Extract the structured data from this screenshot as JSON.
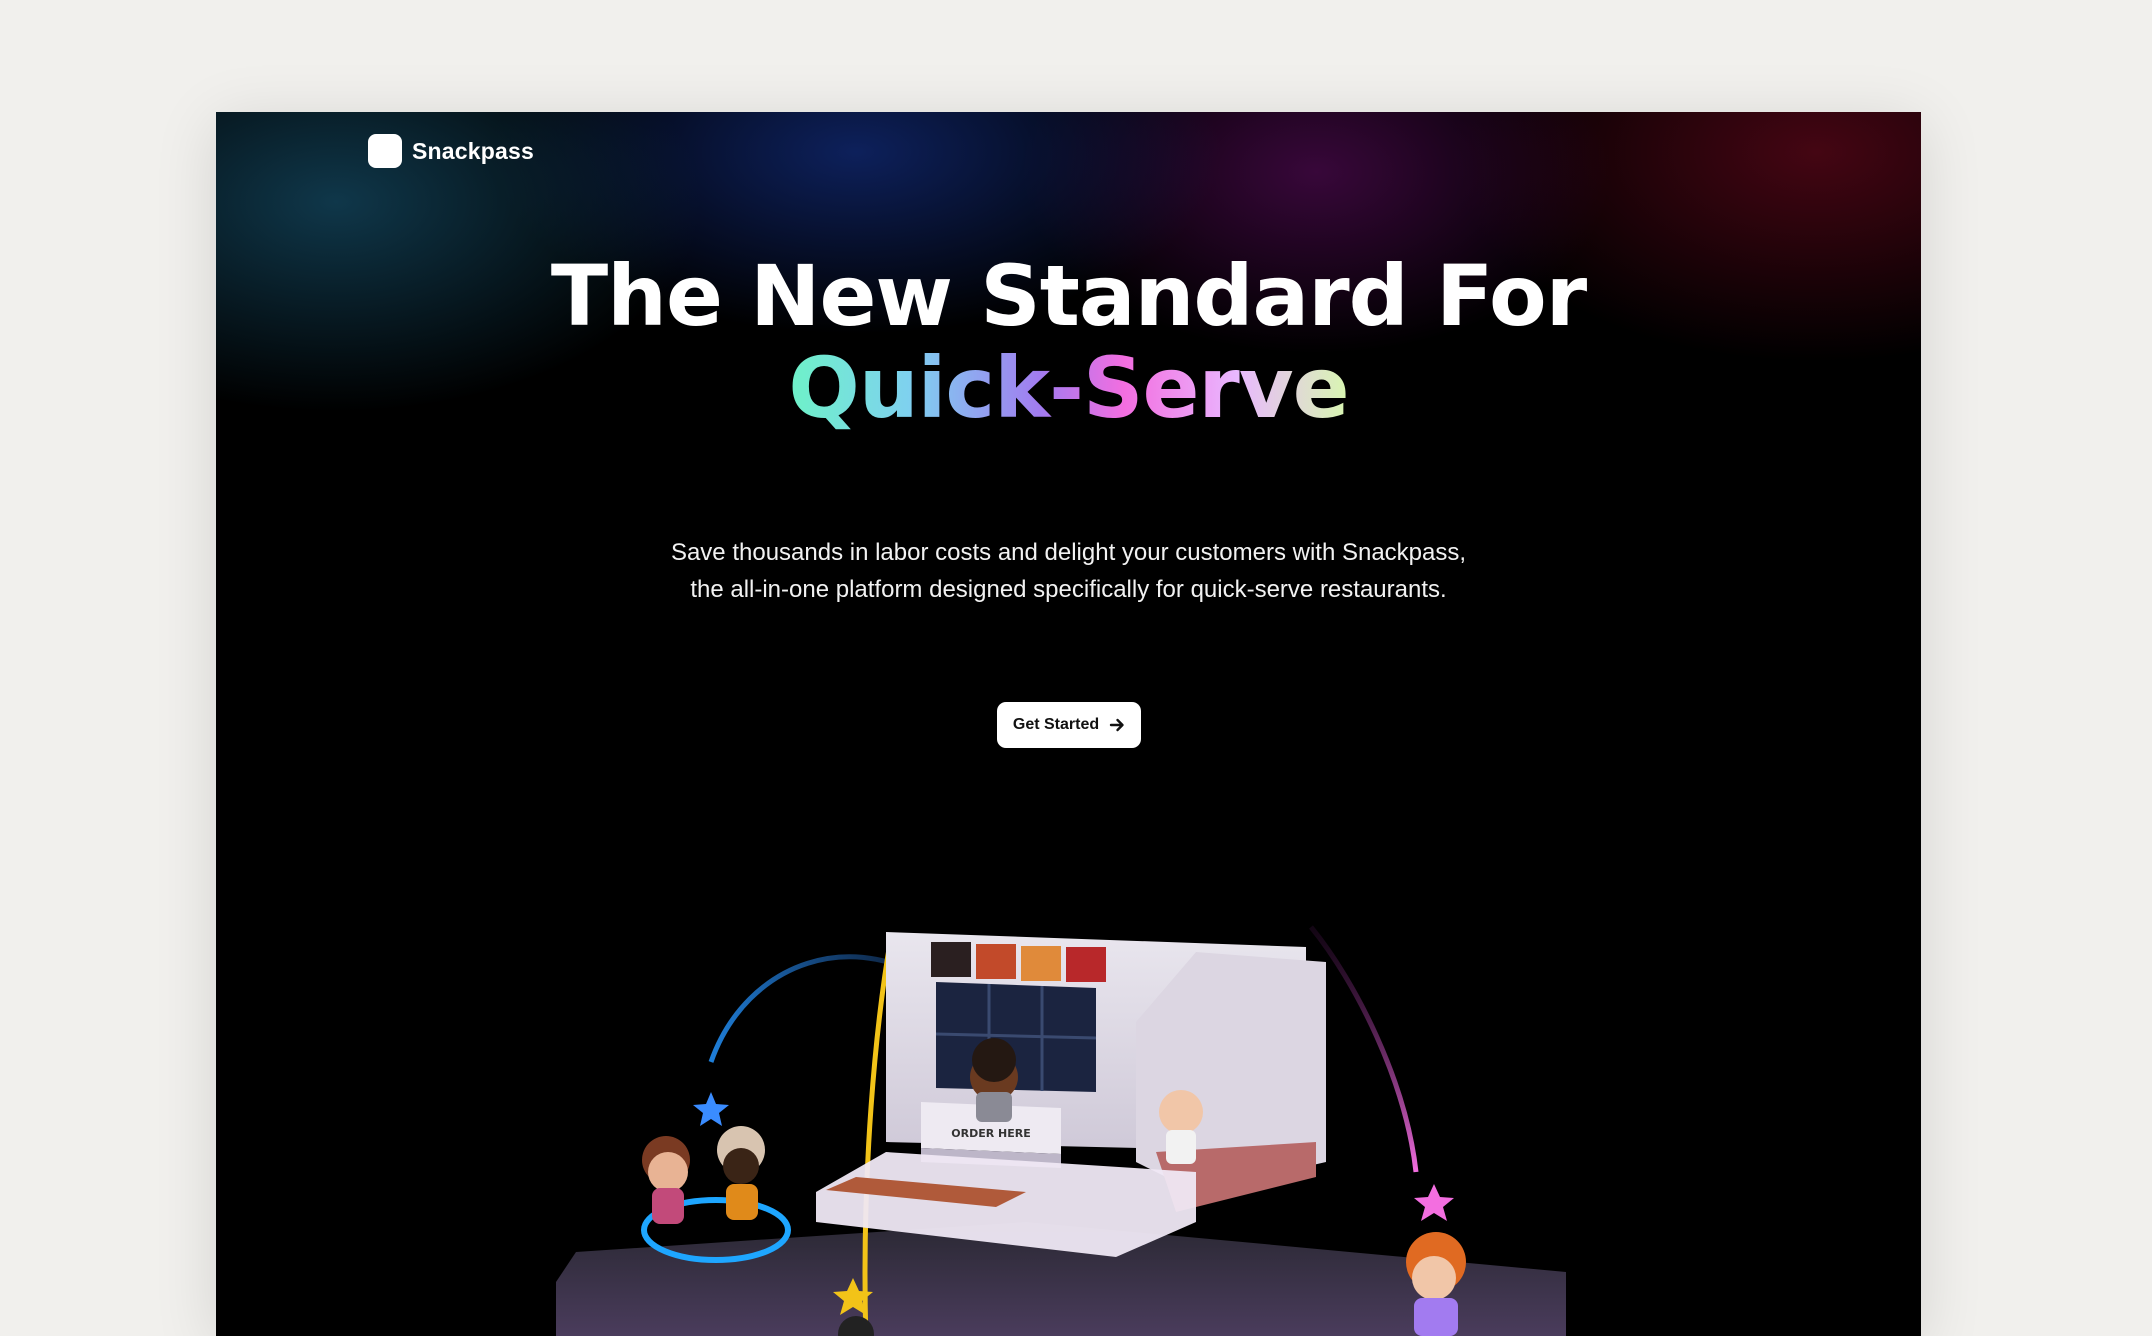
{
  "brand": {
    "name": "Snackpass"
  },
  "hero": {
    "title_line1": "The New Standard For",
    "title_line2": "Quick-Serve",
    "subtitle_line1": "Save thousands in labor costs and delight your customers with Snackpass,",
    "subtitle_line2": "the all-in-one platform designed specifically for quick-serve restaurants.",
    "cta_label": "Get Started",
    "cta_icon": "arrow-right-icon"
  },
  "illustration": {
    "counter_sign": "ORDER HERE"
  },
  "colors": {
    "page_background": "#f1f0ed",
    "hero_background": "#000000",
    "gradient_text": [
      "#6ef2c8",
      "#a27bf0",
      "#f36ee0",
      "#d8f7b0"
    ]
  }
}
